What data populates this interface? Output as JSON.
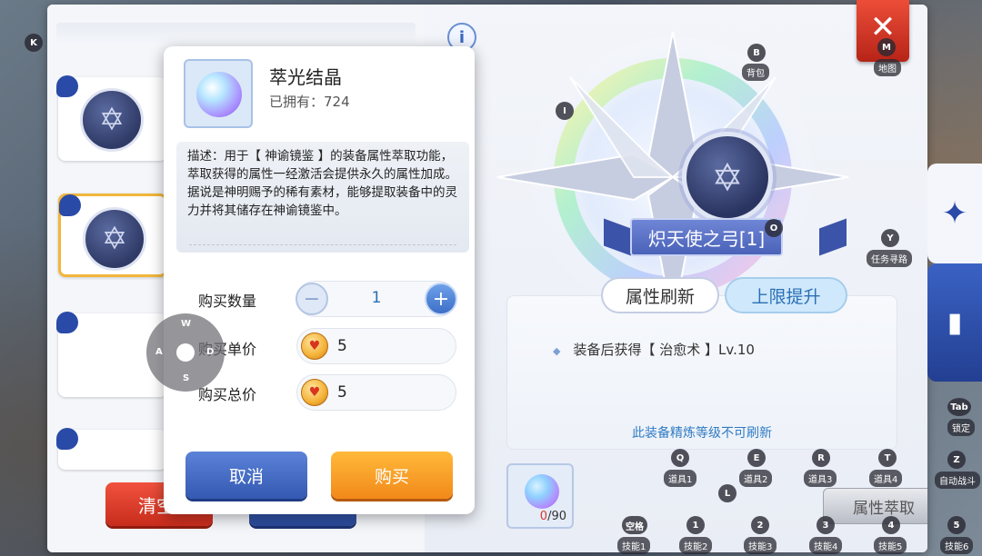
{
  "left_panel": {
    "slots": [
      {
        "name": "slot-1"
      },
      {
        "name": "slot-2"
      },
      {
        "name": "slot-3"
      },
      {
        "name": "slot-4"
      }
    ],
    "clear_button_label": "清空"
  },
  "info_icon_label": "i",
  "equipment": {
    "name": "炽天使之弓[1]",
    "tabs": [
      "属性刷新",
      "上限提升"
    ],
    "attribute_line": "装备后获得【 治愈术 】Lv.10",
    "note": "此装备精炼等级不可刷新",
    "material_count": "0",
    "material_required": "/90",
    "extract_button_label": "属性萃取"
  },
  "popup": {
    "item_name": "萃光结晶",
    "owned_label": "已拥有：724",
    "description_1": "描述：用于【 神谕镜鉴 】的装备属性萃取功能，萃取获得的属性一经激活会提供永久的属性加成。",
    "description_2": "据说是神明赐予的稀有素材，能够提取装备中的灵力并将其储存在神谕镜鉴中。",
    "quantity_label": "购买数量",
    "quantity_value": "1",
    "unit_price_label": "购买单价",
    "unit_price_value": "5",
    "total_price_label": "购买总价",
    "total_price_value": "5",
    "cancel_label": "取消",
    "buy_label": "购买"
  },
  "joystick": {
    "up": "W",
    "left": "A",
    "down": "S",
    "right": "D"
  },
  "close_label": "✕",
  "hotkeys": [
    {
      "key": "K",
      "label": ""
    },
    {
      "key": "M",
      "label": "地图"
    },
    {
      "key": "B",
      "label": "背包"
    },
    {
      "key": "I",
      "label": ""
    },
    {
      "key": "O",
      "label": ""
    },
    {
      "key": "Y",
      "label": "任务寻路"
    },
    {
      "key": "Tab",
      "label": "锁定"
    },
    {
      "key": "Z",
      "label": "自动战斗"
    },
    {
      "key": "Q",
      "label": "道具1"
    },
    {
      "key": "E",
      "label": "道具2"
    },
    {
      "key": "R",
      "label": "道具3"
    },
    {
      "key": "T",
      "label": "道具4"
    },
    {
      "key": "L",
      "label": ""
    },
    {
      "key": "空格",
      "label": "技能1"
    },
    {
      "key": "1",
      "label": "技能2"
    },
    {
      "key": "2",
      "label": "技能3"
    },
    {
      "key": "3",
      "label": "技能4"
    },
    {
      "key": "4",
      "label": "技能5"
    },
    {
      "key": "5",
      "label": "技能6"
    }
  ],
  "colors": {
    "accent_blue": "#3459b2",
    "accent_orange": "#f2891a",
    "accent_red": "#c82c1c",
    "selected_border": "#f2b63a"
  }
}
